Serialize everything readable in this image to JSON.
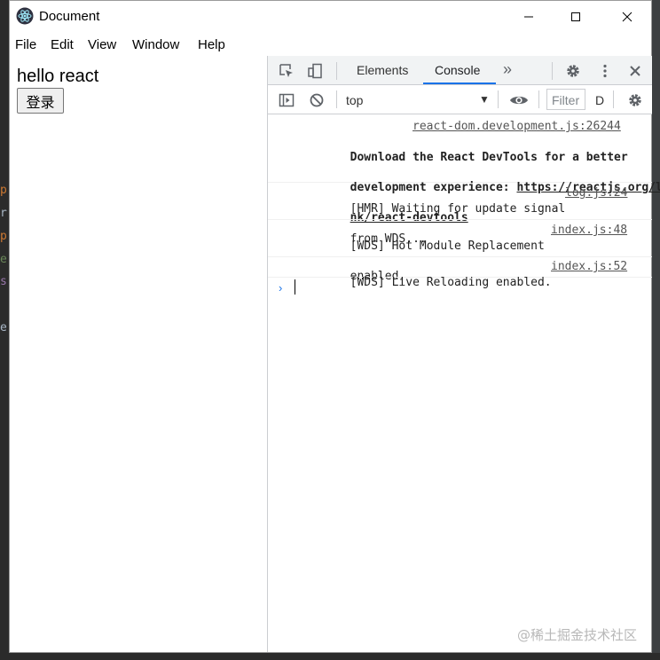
{
  "window": {
    "title": "Document"
  },
  "menu": [
    "File",
    "Edit",
    "View",
    "Window",
    "Help"
  ],
  "app": {
    "heading": "hello react",
    "login_button": "登录"
  },
  "devtools": {
    "tabs": {
      "elements": "Elements",
      "console": "Console",
      "more": "»"
    },
    "context": "top",
    "filter_placeholder": "Filter",
    "levels": "D",
    "messages": [
      {
        "source": "react-dom.development.js:26244",
        "line1_prefix": "Download the React DevTools for a better",
        "line2_prefix": "development experience: ",
        "line2_url": "https://reactjs.org/li",
        "line3_url": "nk/react-devtools"
      },
      {
        "line1": "[HMR] Waiting for update signal",
        "line2": "from WDS...",
        "source": "log.js:24"
      },
      {
        "line1": "[WDS] Hot Module Replacement",
        "line2": "enabled.",
        "source": "index.js:48"
      },
      {
        "line1": "[WDS] Live Reloading enabled.",
        "source": "index.js:52"
      }
    ],
    "prompt": "›"
  },
  "background_chars": [
    "p",
    "r",
    "p",
    "e",
    "s",
    "e"
  ],
  "watermark": "@稀土掘金技术社区",
  "colors": {
    "accent": "#1a73e8",
    "bg_dark": "#2b2b2b"
  }
}
